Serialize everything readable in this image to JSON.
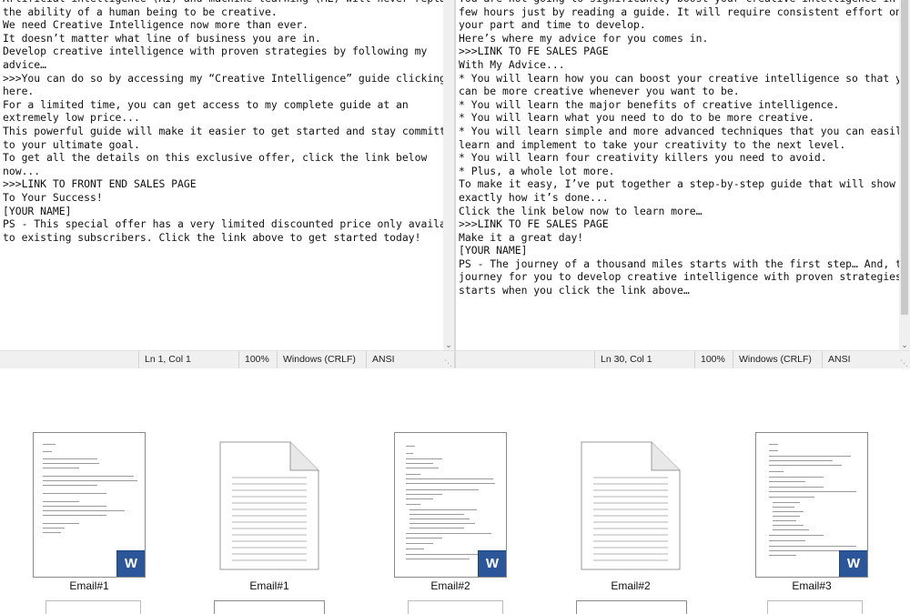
{
  "left_editor": {
    "lines": [
      "Artificial intelligence (AI) and machine learning (ML) will never replace",
      "the ability of a human being to be creative.",
      "We need Creative Intelligence now more than ever.",
      "It doesn’t matter what line of business you are in.",
      "Develop creative intelligence with proven strategies by following my",
      "advice…",
      ">>>You can do so by accessing my “Creative Intelligence” guide clicking",
      "here.",
      "For a limited time, you can get access to my complete guide at an",
      "extremely low price...",
      "This powerful guide will make it easier to get started and stay committed",
      "to your ultimate goal.",
      "To get all the details on this exclusive offer, click the link below",
      "now...",
      ">>>LINK TO FRONT END SALES PAGE",
      "To Your Success!",
      "[YOUR NAME]",
      "PS - This special offer has a very limited discounted price only available",
      "to existing subscribers. Click the link above to get started today!"
    ],
    "status": {
      "position": "Ln 1, Col 1",
      "zoom": "100%",
      "line_ending": "Windows (CRLF)",
      "encoding": "ANSI"
    }
  },
  "right_editor": {
    "lines": [
      "You are not going to significantly boost your creative intelligence in a",
      "few hours just by reading a guide. It will require consistent effort on",
      "your part and time to develop.",
      "Here’s where my advice for you comes in.",
      ">>>LINK TO FE SALES PAGE",
      "With My Advice...",
      "* You will learn how you can boost your creative intelligence so that you",
      "can be more creative whenever you want to be.",
      "* You will learn the major benefits of creative intelligence.",
      "* You will learn what you need to do to be more creative.",
      "* You will learn simple and more advanced techniques that you can easily",
      "learn and implement to take your creativity to the next level.",
      "* You will learn four creativity killers you need to avoid.",
      "* Plus, a whole lot more.",
      "To make it easy, I’ve put together a step-by-step guide that will show you",
      "exactly how it’s done...",
      "Click the link below now to learn more…",
      ">>>LINK TO FE SALES PAGE",
      "Make it a great day!",
      "[YOUR NAME]",
      "PS - The journey of a thousand miles starts with the first step… And, the",
      "journey for you to develop creative intelligence with proven strategies,",
      "starts when you click the link above…"
    ],
    "status": {
      "position": "Ln 30, Col 1",
      "zoom": "100%",
      "line_ending": "Windows (CRLF)",
      "encoding": "ANSI"
    }
  },
  "files": [
    {
      "name": "Email#1",
      "type": "word",
      "icon": "word-doc-icon"
    },
    {
      "name": "Email#1",
      "type": "text",
      "icon": "text-file-icon"
    },
    {
      "name": "Email#2",
      "type": "word",
      "icon": "word-doc-icon"
    },
    {
      "name": "Email#2",
      "type": "text",
      "icon": "text-file-icon"
    },
    {
      "name": "Email#3",
      "type": "word",
      "icon": "word-doc-icon"
    }
  ],
  "word_badge_letter": "W",
  "colors": {
    "word_blue": "#2b579a",
    "statusbar_bg": "#f0f0f0"
  }
}
